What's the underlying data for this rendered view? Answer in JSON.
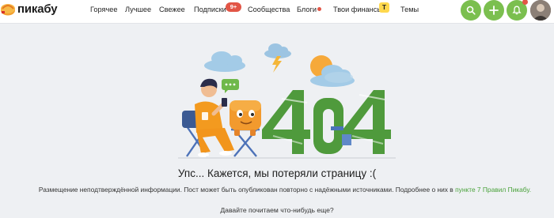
{
  "header": {
    "logo_text": "пикабу",
    "nav": [
      {
        "label": "Горячее"
      },
      {
        "label": "Лучшее"
      },
      {
        "label": "Свежее"
      },
      {
        "label": "Подписки"
      },
      {
        "label": "Сообщества"
      },
      {
        "label": "Блоги"
      },
      {
        "label": "Твои финансы"
      },
      {
        "label": "Темы"
      }
    ],
    "subscriptions_badge": "9+",
    "finance_badge": "Т",
    "buttons": [
      "search-icon",
      "plus-icon",
      "bell-icon"
    ],
    "accent_color": "#7bbf4f"
  },
  "error": {
    "code_graphic": "404",
    "title": "Упс... Кажется, мы потеряли страницу :(",
    "description": "Размещение неподтверждённой информации. Пост может быть опубликован повторно с надёжными источниками. Подробнее о них в ",
    "rules_link": "пункте 7 Правил Пикабу.",
    "ask": "Давайте почитаем что-нибудь еще?"
  }
}
